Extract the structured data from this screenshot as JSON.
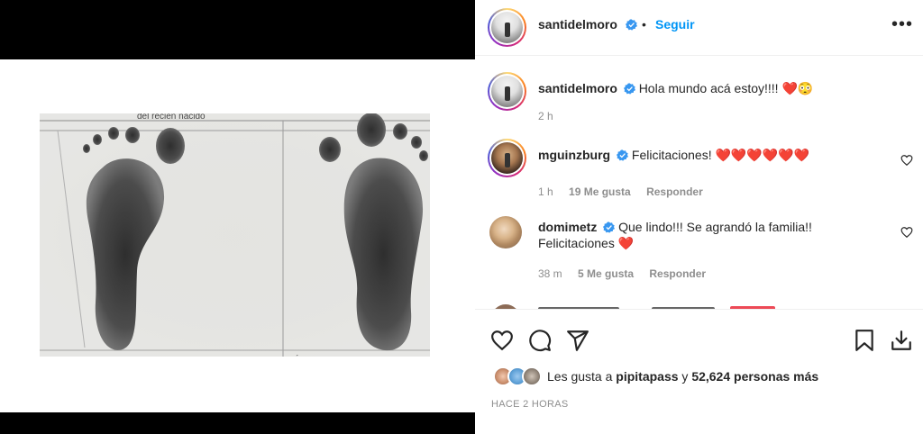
{
  "post": {
    "author": "santidelmoro",
    "follow_label": "Seguir",
    "dot": "•",
    "more_label": "•••"
  },
  "caption": {
    "username": "santidelmoro",
    "text": "Hola mundo acá estoy!!!! ❤️😳",
    "time": "2 h"
  },
  "comments": [
    {
      "username": "mguinzburg",
      "text": "Felicitaciones! ❤️❤️❤️❤️❤️❤️",
      "time": "1 h",
      "likes": "19 Me gusta",
      "reply": "Responder"
    },
    {
      "username": "domimetz",
      "text": "Que lindo!!! Se agrandó la familia!!",
      "text2": "Felicitaciones ❤️",
      "time": "38 m",
      "likes": "5 Me gusta",
      "reply": "Responder"
    }
  ],
  "likes": {
    "prefix": "Les gusta a ",
    "user": "pipitapass",
    "middle": " y ",
    "count": "52,624 personas más"
  },
  "timestamp": "HACE 2 HORAS",
  "icons": [
    "verified-icon",
    "heart-icon",
    "comment-icon",
    "share-icon",
    "save-icon",
    "download-icon"
  ]
}
